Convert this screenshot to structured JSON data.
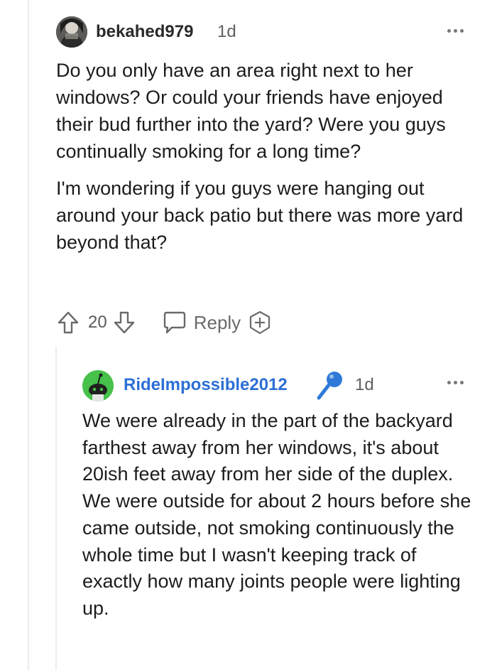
{
  "comments": [
    {
      "username": "bekahed979",
      "timestamp": "1d",
      "paragraphs": [
        "Do you only have an area right next to her windows? Or could your friends have enjoyed their bud further into the yard? Were you guys continually smoking for a long time?",
        "I'm wondering if you guys were hanging out around your back patio but there was more yard beyond that?"
      ],
      "vote_count": "20",
      "reply_label": "Reply"
    },
    {
      "username": "RideImpossible2012",
      "timestamp": "1d",
      "paragraphs": [
        "We were already in the part of the backyard farthest away from her windows, it's about 20ish feet away from her side of the duplex. We were outside for about 2 hours before she came outside, not smoking continuously the whole time but I wasn't keeping track of exactly how many joints people were lighting up."
      ]
    }
  ],
  "colors": {
    "username_reply": "#2d6fd6",
    "avatar_green": "#46c14a",
    "mic_blue": "#2f7ad8"
  },
  "icons": [
    "more-options-icon",
    "upvote-icon",
    "downvote-icon",
    "reply-icon",
    "award-icon",
    "microphone-icon",
    "snoo-avatar-icon"
  ]
}
